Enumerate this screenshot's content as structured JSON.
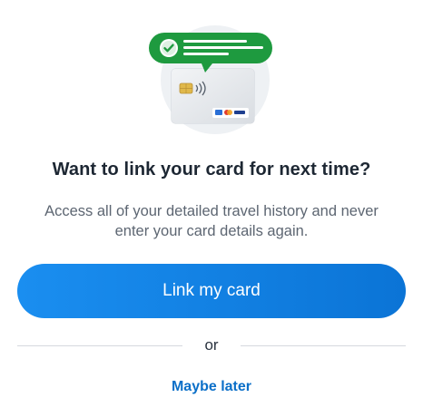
{
  "illustration": {
    "card_icon": "contactless-card-icon",
    "badge_icon": "check-circle-icon",
    "brand_green": "#1e9a3f",
    "card_color": "#e6e8eb"
  },
  "title": "Want to link your card for next time?",
  "description": "Access all of your detailed travel history and never enter your card details again.",
  "primary_action": {
    "label": "Link my card",
    "color": "#0b74d6"
  },
  "divider": {
    "label": "or"
  },
  "secondary_action": {
    "label": "Maybe later",
    "color": "#0b6fc8"
  }
}
